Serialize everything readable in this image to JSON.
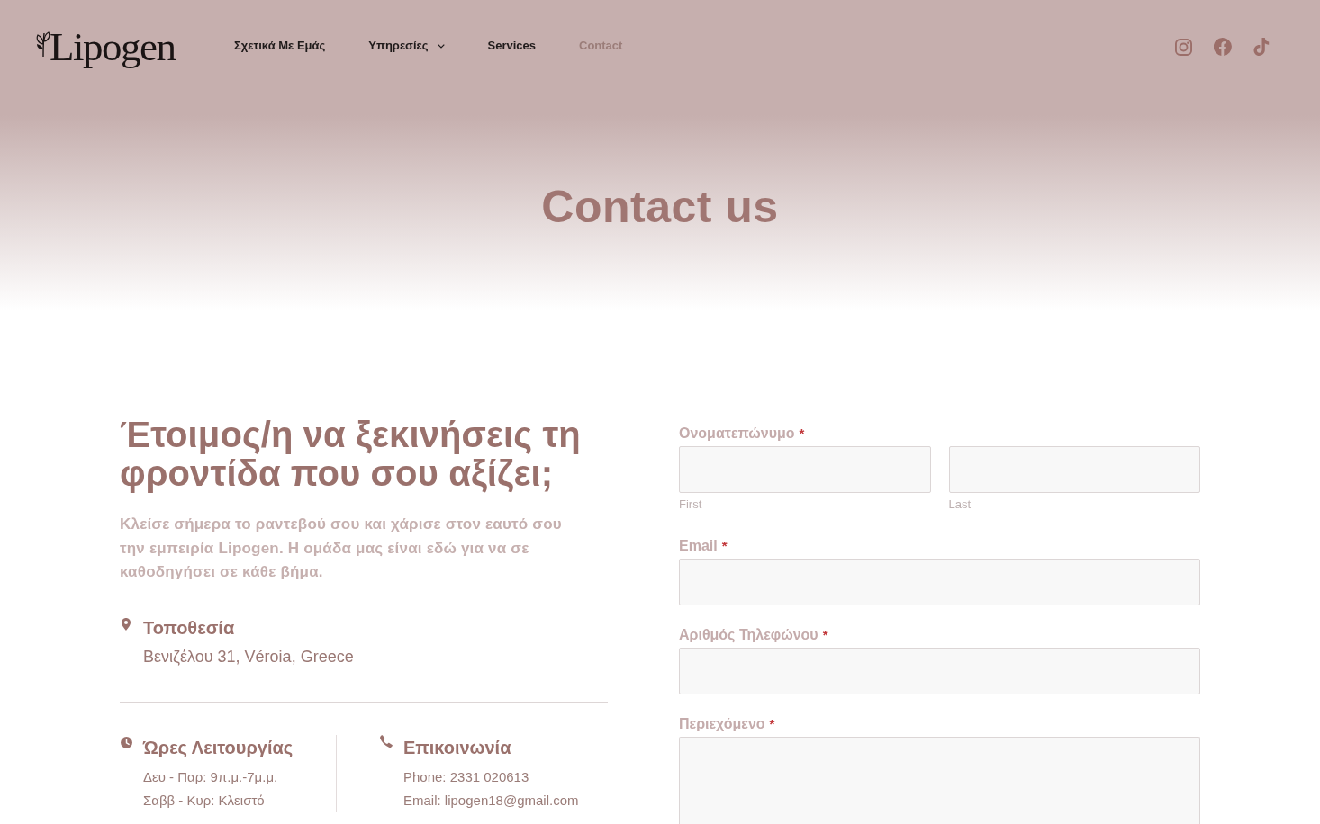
{
  "header": {
    "logo": "Lipogen",
    "nav": [
      {
        "label": "Σχετικά Με Εμάς",
        "selected": false,
        "has_dropdown": false
      },
      {
        "label": "Υπηρεσίες",
        "selected": false,
        "has_dropdown": true
      },
      {
        "label": "Services",
        "selected": false,
        "has_dropdown": false
      },
      {
        "label": "Contact",
        "selected": true,
        "has_dropdown": false
      }
    ]
  },
  "hero": {
    "title": "Contact us"
  },
  "intro": {
    "heading": "Έτοιμος/η να ξεκινήσεις τη φροντίδα που σου αξίζει;",
    "text": "Κλείσε σήμερα το ραντεβού σου και χάρισε στον εαυτό σου την εμπειρία Lipogen. Η ομάδα μας είναι εδώ για να σε καθοδηγήσει σε κάθε βήμα."
  },
  "location": {
    "title": "Τοποθεσία",
    "lines": [
      "Βενιζέλου 31, Véroia, Greece"
    ]
  },
  "info_blocks": [
    {
      "title": "Ώρες Λειτουργίας",
      "lines": [
        "Δευ - Παρ: 9π.μ.-7μ.μ.",
        "Σαββ - Κυρ: Κλειστό"
      ]
    },
    {
      "title": "Επικοινωνία",
      "lines": [
        "Phone: 2331 020613",
        "Email: lipogen18@gmail.com"
      ]
    }
  ],
  "form": {
    "required_mark": "*",
    "fields": [
      {
        "kind": "name",
        "label": "Ονοματεπώνυμο",
        "required": true,
        "parts": [
          {
            "sublabel": "First"
          },
          {
            "sublabel": "Last"
          }
        ]
      },
      {
        "kind": "input",
        "label": "Email",
        "required": true
      },
      {
        "kind": "input",
        "label": "Αριθμός Τηλεφώνου",
        "required": true
      },
      {
        "kind": "textarea",
        "label": "Περιεχόμενο",
        "required": true
      }
    ]
  }
}
